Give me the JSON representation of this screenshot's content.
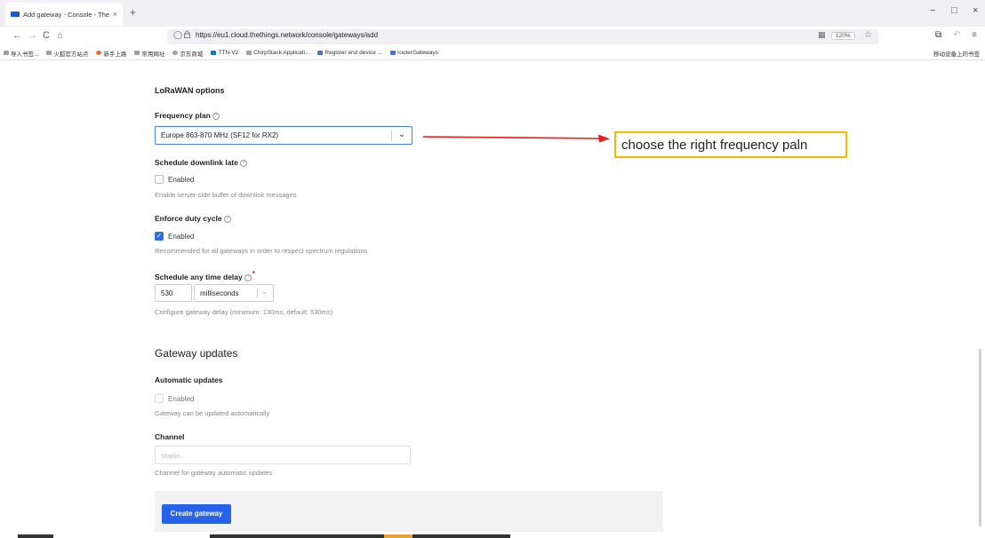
{
  "browser": {
    "tab_title": "Add gateway - Console - The",
    "tab_close": "×",
    "new_tab": "+",
    "window": {
      "min": "−",
      "max": "□",
      "close": "×"
    },
    "nav": {
      "back": "←",
      "forward": "→",
      "reload": "C",
      "home": "⌂"
    },
    "url": "https://eu1.cloud.thethings.network/console/gateways/add",
    "zoom": "120%",
    "bookmarks": [
      {
        "label": "导入书签...",
        "icon": "bookmark-folder-icon",
        "color": "#9aa0a6"
      },
      {
        "label": "火狐官方站点",
        "icon": "folder-icon",
        "color": "#9aa0a6"
      },
      {
        "label": "新手上路",
        "icon": "firefox-icon",
        "color": "#e8702a"
      },
      {
        "label": "常用网址",
        "icon": "folder-icon",
        "color": "#9aa0a6"
      },
      {
        "label": "京东商城",
        "icon": "globe-icon",
        "color": "#9aa0a6"
      },
      {
        "label": "TTN-V2",
        "icon": "ttn-icon",
        "color": "#0b79d0"
      },
      {
        "label": "ChirpStack Applicati...",
        "icon": "link-icon",
        "color": "#9aa0a6"
      },
      {
        "label": "Register end device ...",
        "icon": "ttn-icon",
        "color": "#4a6ee0"
      },
      {
        "label": "routerGateways",
        "icon": "ttn-icon",
        "color": "#4a6ee0"
      }
    ],
    "mobile_bookmarks": "移动设备上的书签"
  },
  "form": {
    "lorawan_heading": "LoRaWAN options",
    "frequency_plan": {
      "label": "Frequency plan",
      "value": "Europe 863-870 MHz (SF12 for RX2)"
    },
    "schedule_downlink_late": {
      "label": "Schedule downlink late",
      "checkbox_label": "Enabled",
      "checked": false,
      "description": "Enable server-side buffer of downlink messages"
    },
    "enforce_duty_cycle": {
      "label": "Enforce duty cycle",
      "checkbox_label": "Enabled",
      "checked": true,
      "description": "Recommended for all gateways in order to respect spectrum regulations"
    },
    "schedule_any_time_delay": {
      "label": "Schedule any time delay",
      "required_mark": "*",
      "value": "530",
      "unit": "milliseconds",
      "description": "Configure gateway delay (minimum: 130ms, default: 530ms)"
    },
    "gateway_updates_heading": "Gateway updates",
    "automatic_updates": {
      "label": "Automatic updates",
      "checkbox_label": "Enabled",
      "checked": false,
      "description": "Gateway can be updated automatically"
    },
    "channel": {
      "label": "Channel",
      "placeholder": "Stable",
      "description": "Channel for gateway automatic updates"
    },
    "submit_label": "Create gateway"
  },
  "annotation": {
    "text": "choose the right frequency paln",
    "arrow_color": "#e8201a",
    "border_color": "#f6b900"
  },
  "colors": {
    "primary": "#2563eb",
    "checkbox_checked": "#2d6fde",
    "select_focus_border": "#4a7fd6"
  }
}
